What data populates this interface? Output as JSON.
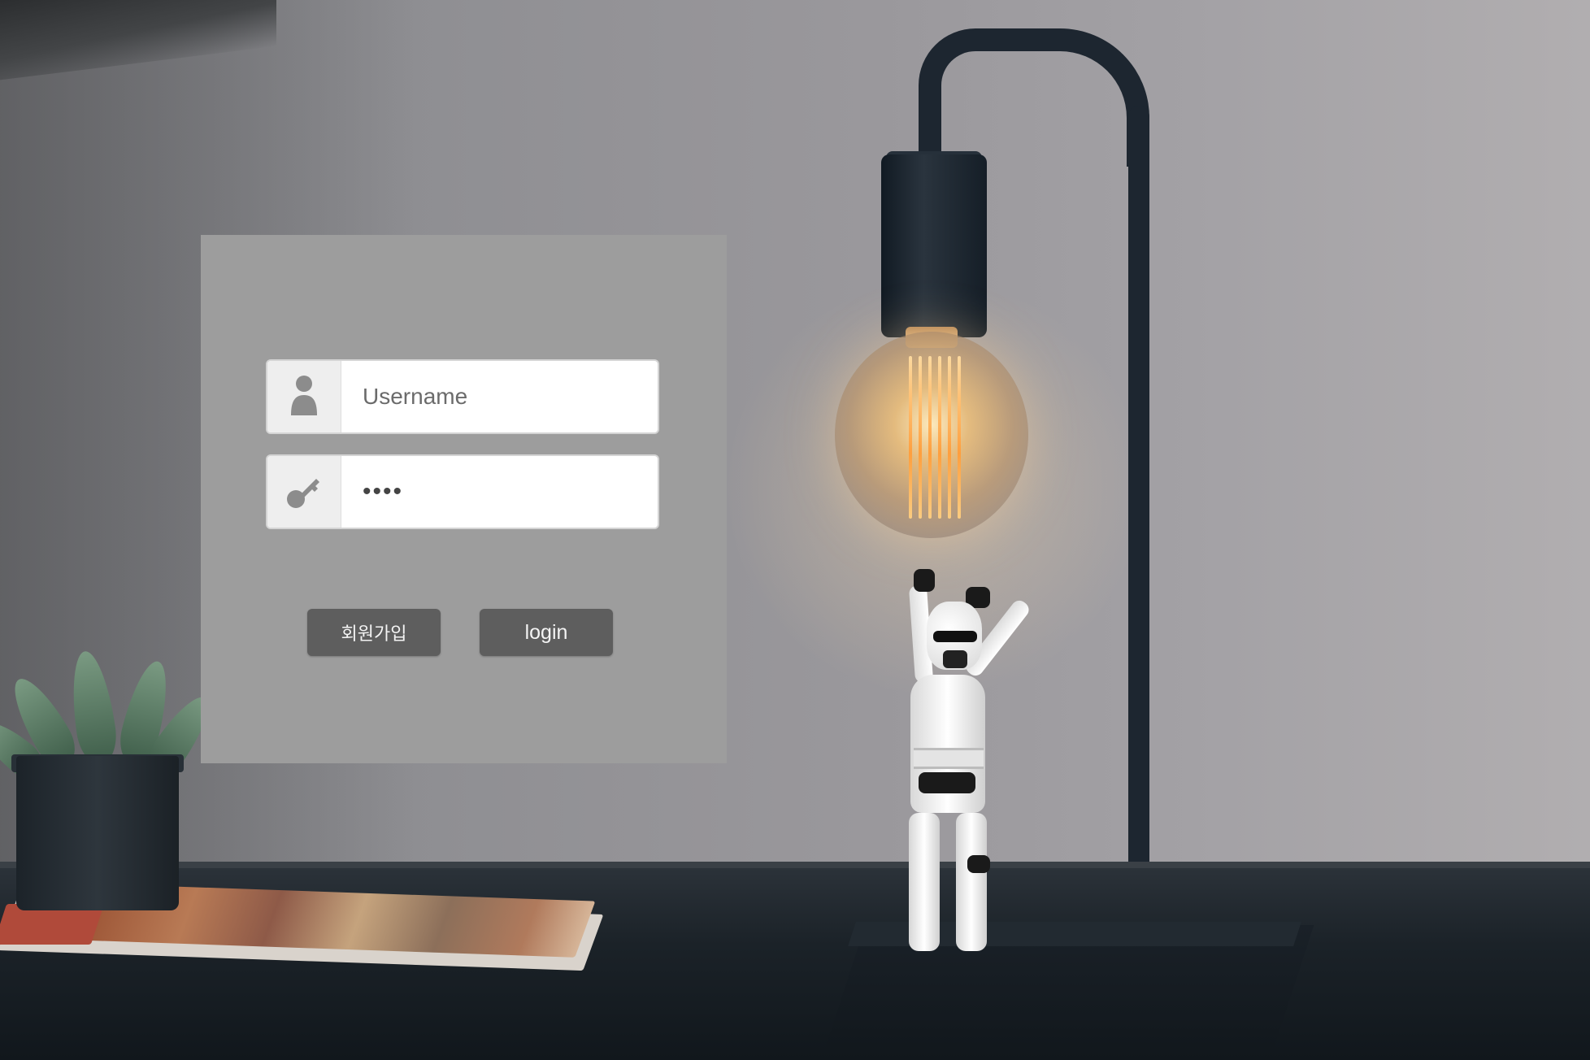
{
  "login_form": {
    "username": {
      "placeholder": "Username",
      "value": "",
      "icon": "user-icon"
    },
    "password": {
      "value": "••••",
      "icon": "key-icon"
    },
    "buttons": {
      "signup_label": "회원가입",
      "login_label": "login"
    }
  },
  "colors": {
    "panel_background": "#9d9d9d",
    "button_background": "#5e5e5e",
    "button_text": "#f4f4f4",
    "input_background": "#ffffff",
    "icon_box_background": "#eeeeee",
    "icon_color": "#8c8c8c"
  }
}
